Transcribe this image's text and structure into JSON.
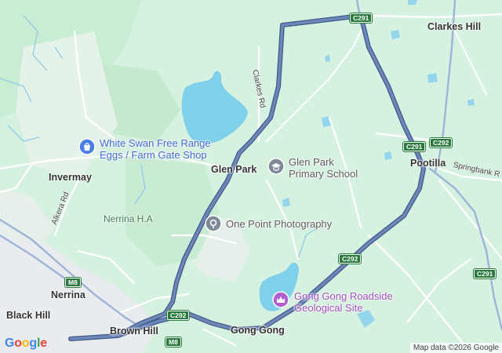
{
  "map": {
    "towns": {
      "clarkes_hill": "Clarkes Hill",
      "glen_park": "Glen Park",
      "pootilla": "Pootilla",
      "invermay": "Invermay",
      "nerrina": "Nerrina",
      "black_hill": "Black Hill",
      "brown_hill": "Brown Hill",
      "gong_gong": "Gong Gong"
    },
    "pois": {
      "white_swan_line1": "White Swan Free Range",
      "white_swan_line2": "Eggs / Farm Gate Shop",
      "glen_park_school_line1": "Glen Park",
      "glen_park_school_line2": "Primary School",
      "one_point": "One Point Photography",
      "gong_gong_site_line1": "Gong Gong Roadside",
      "gong_gong_site_line2": "Geological Site"
    },
    "parks": {
      "nerrina_ha": "Nerrina H.A"
    },
    "roads": {
      "clarkes_rd": "Clarkes Rd",
      "alkera_rd": "Alkera Rd",
      "springbank_rd": "Springbank R"
    },
    "shields": {
      "c291_top": "C291",
      "c291_mid": "C291",
      "c292_mid": "C292",
      "c292_south": "C292",
      "c292_bottom": "C292",
      "c291_east": "C291",
      "m8_left": "M8",
      "m8_bottom": "M8"
    },
    "icons": {
      "white_swan": "shopping-bag-icon",
      "school": "school-cap-icon",
      "camera": "location-pin-icon",
      "geology": "crown-landmark-icon"
    },
    "colors": {
      "route": "#5a6f9e",
      "shield": "#2a7a3d",
      "water": "#7fd0ea",
      "land": "#d5f1df"
    }
  },
  "attribution": "Map data ©2026 Google",
  "logo": "Google"
}
